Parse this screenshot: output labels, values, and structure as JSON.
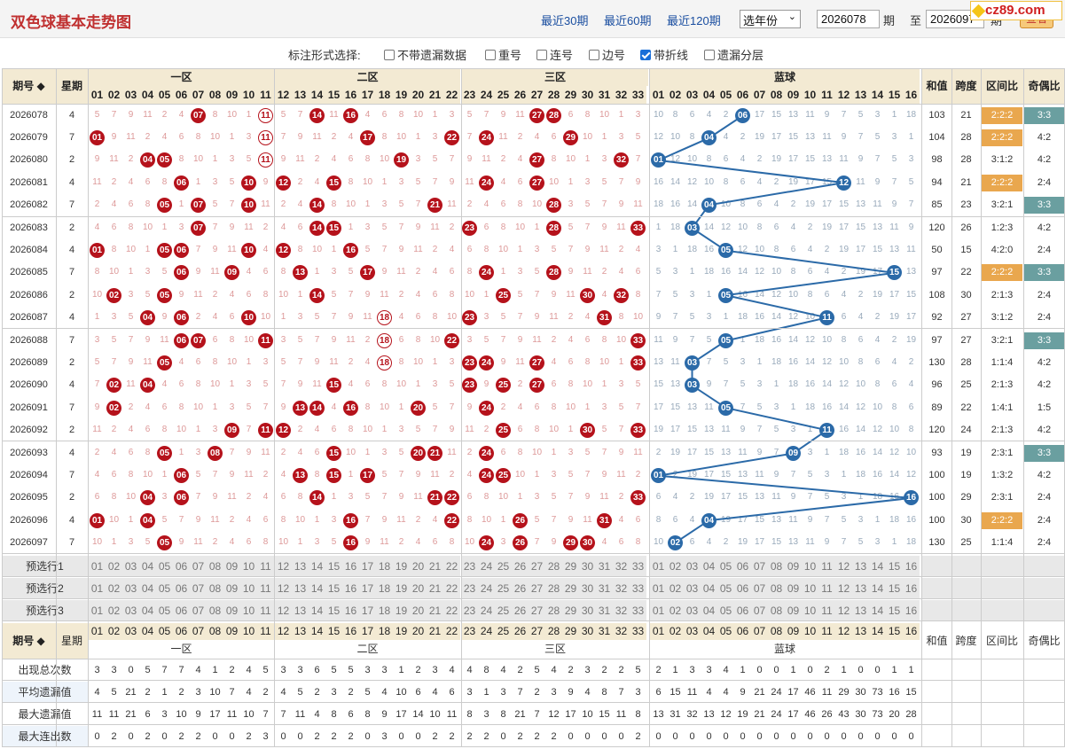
{
  "header": {
    "title": "双色球基本走势图",
    "links": [
      "最近30期",
      "最近60期",
      "最近120期"
    ],
    "year_select": "选年份",
    "from": "2026078",
    "to_label_from": "期",
    "to_label_to": "至",
    "to": "2026097",
    "to_suffix": "期",
    "query": "查看",
    "watermark": "cz89.com"
  },
  "options": {
    "label": "标注形式选择:",
    "items": [
      {
        "label": "不带遗漏数据",
        "checked": false
      },
      {
        "label": "重号",
        "checked": false
      },
      {
        "label": "连号",
        "checked": false
      },
      {
        "label": "边号",
        "checked": false
      },
      {
        "label": "带折线",
        "checked": true
      },
      {
        "label": "遗漏分层",
        "checked": false
      }
    ]
  },
  "table": {
    "head": {
      "issue": "期号",
      "issue_sort": "◆",
      "weekday": "星期",
      "zones": [
        "一区",
        "二区",
        "三区",
        "蓝球"
      ],
      "stats": [
        "和值",
        "跨度",
        "区间比",
        "奇偶比"
      ]
    },
    "red_numbers": [
      "01",
      "02",
      "03",
      "04",
      "05",
      "06",
      "07",
      "08",
      "09",
      "10",
      "11",
      "12",
      "13",
      "14",
      "15",
      "16",
      "17",
      "18",
      "19",
      "20",
      "21",
      "22",
      "23",
      "24",
      "25",
      "26",
      "27",
      "28",
      "29",
      "30",
      "31",
      "32",
      "33"
    ],
    "blue_numbers": [
      "01",
      "02",
      "03",
      "04",
      "05",
      "06",
      "07",
      "08",
      "09",
      "10",
      "11",
      "12",
      "13",
      "14",
      "15",
      "16"
    ],
    "rows": [
      {
        "issue": "2026078",
        "weekday": "4",
        "red": [
          "07",
          "11",
          "14",
          "16",
          "27",
          "28"
        ],
        "blue": "06",
        "sum": "103",
        "span": "21",
        "zone": "2:2:2",
        "zone_hl": true,
        "oe": "3:3",
        "oe_hl": true
      },
      {
        "issue": "2026079",
        "weekday": "7",
        "red": [
          "01",
          "11",
          "17",
          "22",
          "24",
          "29"
        ],
        "blue": "04",
        "sum": "104",
        "span": "28",
        "zone": "2:2:2",
        "zone_hl": true,
        "oe": "4:2",
        "oe_hl": false
      },
      {
        "issue": "2026080",
        "weekday": "2",
        "red": [
          "04",
          "05",
          "11",
          "19",
          "27",
          "32"
        ],
        "blue": "01",
        "sum": "98",
        "span": "28",
        "zone": "3:1:2",
        "zone_hl": false,
        "oe": "4:2",
        "oe_hl": false
      },
      {
        "issue": "2026081",
        "weekday": "4",
        "red": [
          "06",
          "10",
          "12",
          "15",
          "24",
          "27"
        ],
        "blue": "12",
        "sum": "94",
        "span": "21",
        "zone": "2:2:2",
        "zone_hl": true,
        "oe": "2:4",
        "oe_hl": false
      },
      {
        "issue": "2026082",
        "weekday": "7",
        "red": [
          "05",
          "07",
          "10",
          "14",
          "21",
          "28"
        ],
        "blue": "04",
        "sum": "85",
        "span": "23",
        "zone": "3:2:1",
        "zone_hl": false,
        "oe": "3:3",
        "oe_hl": true
      },
      {
        "issue": "2026083",
        "weekday": "2",
        "red": [
          "07",
          "14",
          "15",
          "23",
          "28",
          "33"
        ],
        "blue": "03",
        "sum": "120",
        "span": "26",
        "zone": "1:2:3",
        "zone_hl": false,
        "oe": "4:2",
        "oe_hl": false
      },
      {
        "issue": "2026084",
        "weekday": "4",
        "red": [
          "01",
          "05",
          "06",
          "10",
          "12",
          "16"
        ],
        "blue": "05",
        "sum": "50",
        "span": "15",
        "zone": "4:2:0",
        "zone_hl": false,
        "oe": "2:4",
        "oe_hl": false
      },
      {
        "issue": "2026085",
        "weekday": "7",
        "red": [
          "06",
          "09",
          "13",
          "17",
          "24",
          "28"
        ],
        "blue": "15",
        "sum": "97",
        "span": "22",
        "zone": "2:2:2",
        "zone_hl": true,
        "oe": "3:3",
        "oe_hl": true
      },
      {
        "issue": "2026086",
        "weekday": "2",
        "red": [
          "02",
          "05",
          "14",
          "25",
          "30",
          "32"
        ],
        "blue": "05",
        "sum": "108",
        "span": "30",
        "zone": "2:1:3",
        "zone_hl": false,
        "oe": "2:4",
        "oe_hl": false
      },
      {
        "issue": "2026087",
        "weekday": "4",
        "red": [
          "04",
          "06",
          "10",
          "18",
          "23",
          "31"
        ],
        "blue": "11",
        "sum": "92",
        "span": "27",
        "zone": "3:1:2",
        "zone_hl": false,
        "oe": "2:4",
        "oe_hl": false
      },
      {
        "issue": "2026088",
        "weekday": "7",
        "red": [
          "06",
          "07",
          "11",
          "18",
          "22",
          "33"
        ],
        "blue": "05",
        "sum": "97",
        "span": "27",
        "zone": "3:2:1",
        "zone_hl": false,
        "oe": "3:3",
        "oe_hl": true
      },
      {
        "issue": "2026089",
        "weekday": "2",
        "red": [
          "05",
          "18",
          "23",
          "24",
          "27",
          "33"
        ],
        "blue": "03",
        "sum": "130",
        "span": "28",
        "zone": "1:1:4",
        "zone_hl": false,
        "oe": "4:2",
        "oe_hl": false
      },
      {
        "issue": "2026090",
        "weekday": "4",
        "red": [
          "02",
          "04",
          "15",
          "23",
          "25",
          "27"
        ],
        "blue": "03",
        "sum": "96",
        "span": "25",
        "zone": "2:1:3",
        "zone_hl": false,
        "oe": "4:2",
        "oe_hl": false
      },
      {
        "issue": "2026091",
        "weekday": "7",
        "red": [
          "02",
          "13",
          "14",
          "16",
          "20",
          "24"
        ],
        "blue": "05",
        "sum": "89",
        "span": "22",
        "zone": "1:4:1",
        "zone_hl": false,
        "oe": "1:5",
        "oe_hl": false
      },
      {
        "issue": "2026092",
        "weekday": "2",
        "red": [
          "09",
          "11",
          "12",
          "25",
          "30",
          "33"
        ],
        "blue": "11",
        "sum": "120",
        "span": "24",
        "zone": "2:1:3",
        "zone_hl": false,
        "oe": "4:2",
        "oe_hl": false
      },
      {
        "issue": "2026093",
        "weekday": "4",
        "red": [
          "05",
          "08",
          "15",
          "20",
          "21",
          "24"
        ],
        "blue": "09",
        "sum": "93",
        "span": "19",
        "zone": "2:3:1",
        "zone_hl": false,
        "oe": "3:3",
        "oe_hl": true
      },
      {
        "issue": "2026094",
        "weekday": "7",
        "red": [
          "06",
          "13",
          "15",
          "17",
          "24",
          "25"
        ],
        "blue": "01",
        "sum": "100",
        "span": "19",
        "zone": "1:3:2",
        "zone_hl": false,
        "oe": "4:2",
        "oe_hl": false
      },
      {
        "issue": "2026095",
        "weekday": "2",
        "red": [
          "04",
          "06",
          "14",
          "21",
          "22",
          "33"
        ],
        "blue": "16",
        "sum": "100",
        "span": "29",
        "zone": "2:3:1",
        "zone_hl": false,
        "oe": "2:4",
        "oe_hl": false
      },
      {
        "issue": "2026096",
        "weekday": "4",
        "red": [
          "01",
          "04",
          "16",
          "22",
          "26",
          "31"
        ],
        "blue": "04",
        "sum": "100",
        "span": "30",
        "zone": "2:2:2",
        "zone_hl": true,
        "oe": "2:4",
        "oe_hl": false
      },
      {
        "issue": "2026097",
        "weekday": "7",
        "red": [
          "05",
          "16",
          "24",
          "26",
          "29",
          "30"
        ],
        "blue": "02",
        "sum": "130",
        "span": "25",
        "zone": "1:1:4",
        "zone_hl": false,
        "oe": "2:4",
        "oe_hl": false
      }
    ],
    "preselect": [
      "预选行1",
      "预选行2",
      "预选行3"
    ],
    "stats_rows": [
      {
        "label": "出现总次数",
        "red": [
          "3",
          "3",
          "0",
          "5",
          "7",
          "7",
          "4",
          "1",
          "2",
          "4",
          "5",
          "3",
          "3",
          "6",
          "5",
          "5",
          "3",
          "3",
          "1",
          "2",
          "3",
          "4",
          "4",
          "8",
          "4",
          "2",
          "5",
          "4",
          "2",
          "3",
          "2",
          "2",
          "5"
        ],
        "blue": [
          "2",
          "1",
          "3",
          "3",
          "4",
          "1",
          "0",
          "0",
          "1",
          "0",
          "2",
          "1",
          "0",
          "0",
          "1",
          "1"
        ]
      },
      {
        "label": "平均遗漏值",
        "red": [
          "4",
          "5",
          "21",
          "2",
          "1",
          "2",
          "3",
          "10",
          "7",
          "4",
          "2",
          "4",
          "5",
          "2",
          "3",
          "2",
          "5",
          "4",
          "10",
          "6",
          "4",
          "6",
          "3",
          "1",
          "3",
          "7",
          "2",
          "3",
          "9",
          "4",
          "8",
          "7",
          "3"
        ],
        "blue": [
          "6",
          "15",
          "11",
          "4",
          "4",
          "9",
          "21",
          "24",
          "17",
          "46",
          "11",
          "29",
          "30",
          "73",
          "16",
          "15"
        ]
      },
      {
        "label": "最大遗漏值",
        "red": [
          "11",
          "11",
          "21",
          "6",
          "3",
          "10",
          "9",
          "17",
          "11",
          "10",
          "7",
          "7",
          "11",
          "4",
          "8",
          "6",
          "8",
          "9",
          "17",
          "14",
          "10",
          "11",
          "8",
          "3",
          "8",
          "21",
          "7",
          "12",
          "17",
          "10",
          "15",
          "11",
          "8"
        ],
        "blue": [
          "13",
          "31",
          "32",
          "13",
          "12",
          "19",
          "21",
          "24",
          "17",
          "46",
          "26",
          "43",
          "30",
          "73",
          "20",
          "28"
        ]
      },
      {
        "label": "最大连出数",
        "red": [
          "0",
          "2",
          "0",
          "2",
          "0",
          "2",
          "2",
          "0",
          "0",
          "2",
          "3",
          "0",
          "0",
          "2",
          "2",
          "2",
          "0",
          "3",
          "0",
          "0",
          "2",
          "2",
          "2",
          "2",
          "0",
          "2",
          "2",
          "2",
          "0",
          "0",
          "0",
          "0",
          "2"
        ],
        "blue": [
          "0",
          "0",
          "0",
          "0",
          "0",
          "0",
          "0",
          "0",
          "0",
          "0",
          "0",
          "0",
          "0",
          "0",
          "0",
          "0"
        ]
      }
    ]
  }
}
